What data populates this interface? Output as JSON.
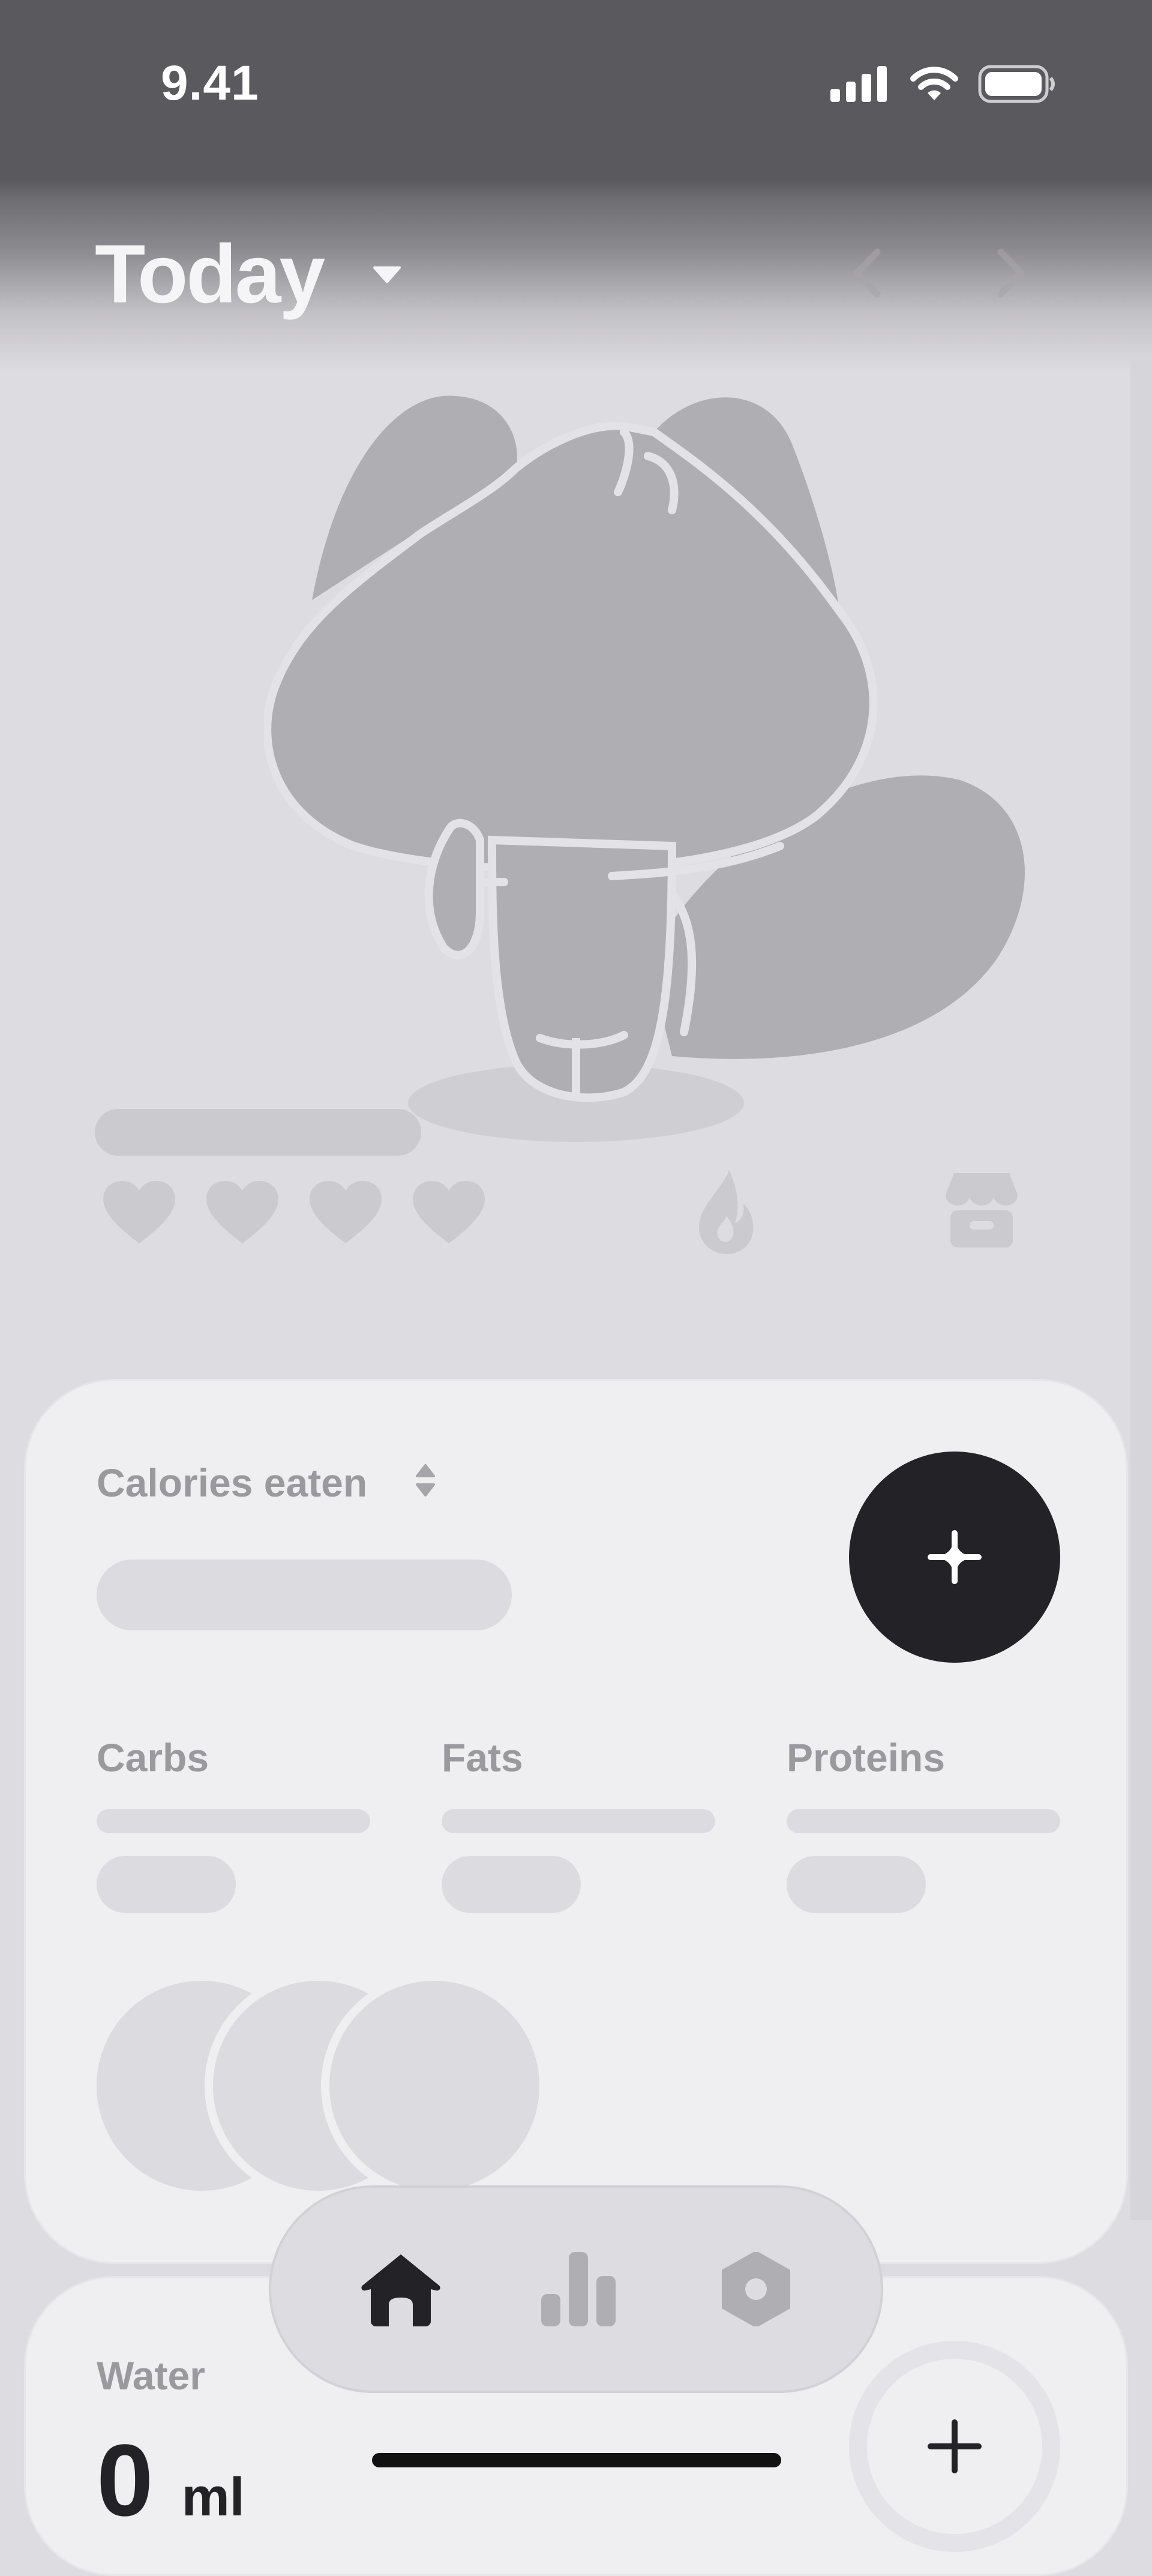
{
  "status_bar": {
    "time": "9.41",
    "icons": [
      "signal-icon",
      "wifi-icon",
      "battery-icon"
    ]
  },
  "header": {
    "title": "Today",
    "icons": [
      "caret-down-icon",
      "chevron-left-icon",
      "chevron-right-icon"
    ]
  },
  "pet": {
    "hearts": 4,
    "icons": [
      "heart-icon",
      "flame-icon",
      "shop-icon"
    ]
  },
  "calories_card": {
    "label": "Calories eaten",
    "macros": [
      {
        "label": "Carbs"
      },
      {
        "label": "Fats"
      },
      {
        "label": "Proteins"
      }
    ]
  },
  "water_card": {
    "label": "Water",
    "value": "0",
    "unit": "ml"
  },
  "tab_bar": {
    "tabs": [
      {
        "name": "home",
        "icon": "home-icon",
        "active": true
      },
      {
        "name": "stats",
        "icon": "bar-chart-icon",
        "active": false
      },
      {
        "name": "settings",
        "icon": "settings-icon",
        "active": false
      }
    ]
  },
  "colors": {
    "background": "#dddce0",
    "card": "#efeef1",
    "accent_dark": "#232226",
    "placeholder": "#dcdbdf",
    "muted_text": "#9a999e"
  }
}
